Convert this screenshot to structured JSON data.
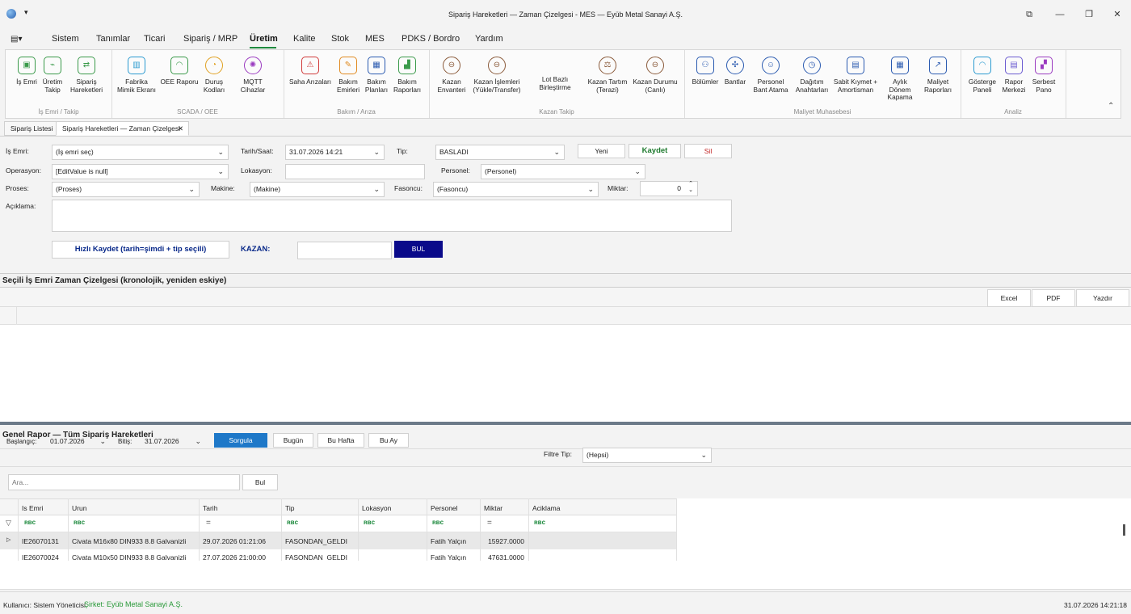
{
  "window": {
    "title": "Sipariş Hareketleri — Zaman Çizelgesi - MES — Eyüb Metal Sanayi A.Ş."
  },
  "menu": {
    "items": [
      "Sistem",
      "Tanımlar",
      "Ticari",
      "Sipariş / MRP",
      "Üretim",
      "Kalite",
      "Stok",
      "MES",
      "PDKS / Bordro",
      "Yardım"
    ],
    "active": "Üretim"
  },
  "ribbon": {
    "groups": {
      "is_emri": "İş Emri / Takip",
      "scada": "SCADA / OEE",
      "bakim": "Bakım / Arıza",
      "kazan": "Kazan Takip",
      "maliyet": "Maliyet Muhasebesi",
      "analiz": "Analiz"
    },
    "buttons": [
      {
        "label": "İş Emri",
        "icon": "work-order-icon",
        "color": "#3a9a4a"
      },
      {
        "label": "Üretim Takip",
        "icon": "production-track-icon",
        "color": "#3a9a4a"
      },
      {
        "label": "Sipariş Hareketleri",
        "icon": "order-movements-icon",
        "color": "#3a9a4a"
      },
      {
        "label": "Fabrika Mimik Ekranı",
        "icon": "factory-mimic-icon",
        "color": "#2a9ad0"
      },
      {
        "label": "OEE Raporu",
        "icon": "oee-report-icon",
        "color": "#3a9a4a"
      },
      {
        "label": "Duruş Kodları",
        "icon": "downtime-codes-icon",
        "color": "#e0a020"
      },
      {
        "label": "MQTT Cihazlar",
        "icon": "mqtt-devices-icon",
        "color": "#9a3ac0"
      },
      {
        "label": "Saha Arızaları",
        "icon": "field-faults-icon",
        "color": "#d03a3a"
      },
      {
        "label": "Bakım Emirleri",
        "icon": "maintenance-orders-icon",
        "color": "#e08a20"
      },
      {
        "label": "Bakım Planları",
        "icon": "maintenance-plans-icon",
        "color": "#2a5ab0"
      },
      {
        "label": "Bakım Raporları",
        "icon": "maintenance-reports-icon",
        "color": "#3a9a4a"
      },
      {
        "label": "Kazan Envanteri",
        "icon": "kettle-inventory-icon",
        "color": "#8a5a3a"
      },
      {
        "label": "Kazan İşlemleri (Yükle/Transfer)",
        "icon": "kettle-operations-icon",
        "color": "#8a5a3a"
      },
      {
        "label": "Lot Bazlı Birleştirme",
        "icon": "",
        "color": ""
      },
      {
        "label": "Kazan Tartım (Terazi)",
        "icon": "scale-icon",
        "color": "#8a5a3a"
      },
      {
        "label": "Kazan Durumu (Canlı)",
        "icon": "kettle-status-icon",
        "color": "#8a5a3a"
      },
      {
        "label": "Bölümler",
        "icon": "departments-icon",
        "color": "#2a5ab0"
      },
      {
        "label": "Bantlar",
        "icon": "lines-icon",
        "color": "#2a5ab0"
      },
      {
        "label": "Personel Bant Atama",
        "icon": "staff-assign-icon",
        "color": "#2a5ab0"
      },
      {
        "label": "Dağıtım Anahtarları",
        "icon": "distribution-keys-icon",
        "color": "#2a5ab0"
      },
      {
        "label": "Sabit Kıymet + Amortisman",
        "icon": "fixed-asset-icon",
        "color": "#2a5ab0"
      },
      {
        "label": "Aylık Dönem Kapama",
        "icon": "period-close-icon",
        "color": "#2a5ab0"
      },
      {
        "label": "Maliyet Raporları",
        "icon": "cost-reports-icon",
        "color": "#2a5ab0"
      },
      {
        "label": "Gösterge Paneli",
        "icon": "dashboard-icon",
        "color": "#2a9ad0"
      },
      {
        "label": "Rapor Merkezi",
        "icon": "report-center-icon",
        "color": "#6a5ad0"
      },
      {
        "label": "Serbest Pano",
        "icon": "free-board-icon",
        "color": "#9a3ac0"
      }
    ]
  },
  "doc_tabs": [
    {
      "label": "Sipariş Listesi"
    },
    {
      "label": "Sipariş Hareketleri — Zaman Çizelgesi"
    }
  ],
  "form": {
    "is_emri_label": "İş Emri:",
    "is_emri_value": "(İş emri seç)",
    "tarih_label": "Tarih/Saat:",
    "tarih_value": "31.07.2026 14:21",
    "tip_label": "Tip:",
    "tip_value": "BASLADI",
    "yeni": "Yeni",
    "kaydet": "Kaydet",
    "sil": "Sil",
    "operasyon_label": "Operasyon:",
    "operasyon_value": "[EditValue is null]",
    "lokasyon_label": "Lokasyon:",
    "lokasyon_value": "",
    "personel_label": "Personel:",
    "personel_value": "(Personel)",
    "proses_label": "Proses:",
    "proses_value": "(Proses)",
    "makine_label": "Makine:",
    "makine_value": "(Makine)",
    "fasoncu_label": "Fasoncu:",
    "fasoncu_value": "(Fasoncu)",
    "miktar_label": "Miktar:",
    "miktar_value": "0",
    "aciklama_label": "Açıklama:",
    "aciklama_value": "",
    "hizli_kaydet": "Hızlı Kaydet (tarih=şimdi + tip seçili)",
    "kazan_label": "KAZAN:",
    "kazan_value": "",
    "bul": "BUL"
  },
  "timeline": {
    "title": "Seçili İş Emri Zaman Çizelgesi (kronolojik, yeniden eskiye)",
    "excel": "Excel",
    "pdf": "PDF",
    "yazdir": "Yazdır"
  },
  "report": {
    "title": "Genel Rapor — Tüm Sipariş Hareketleri",
    "baslangic_label": "Başlangıç:",
    "baslangic_value": "01.07.2026",
    "bitis_label": "Bitiş:",
    "bitis_value": "31.07.2026",
    "sorgula": "Sorgula",
    "bugun": "Bugün",
    "bu_hafta": "Bu Hafta",
    "bu_ay": "Bu Ay",
    "filtre_tip_label": "Filtre Tip:",
    "filtre_tip_value": "(Hepsi)",
    "search_placeholder": "Ara...",
    "bul": "Bul",
    "columns": [
      "Is Emri",
      "Urun",
      "Tarih",
      "Tip",
      "Lokasyon",
      "Personel",
      "Miktar",
      "Aciklama"
    ],
    "filter_eq": "=",
    "rows": [
      {
        "is_emri": "IE26070131",
        "urun": "Civata M16x80 DIN933 8.8 Galvanizli",
        "tarih": "29.07.2026 01:21:06",
        "tip": "FASONDAN_GELDI",
        "lokasyon": "",
        "personel": "Fatih Yalçın",
        "miktar": "15927.0000",
        "aciklama": ""
      },
      {
        "is_emri": "IE26070024",
        "urun": "Civata M10x50 DIN933 8.8 Galvanizli",
        "tarih": "27.07.2026 21:00:00",
        "tip": "FASONDAN_GELDI",
        "lokasyon": "",
        "personel": "Fatih Yalçın",
        "miktar": "47631.0000",
        "aciklama": ""
      }
    ]
  },
  "status": {
    "kullanici": "Kullanıcı: Sistem Yöneticisi",
    "sirket": "Şirket: Eyüb Metal Sanayi A.Ş.",
    "datetime": "31.07.2026 14:21:18"
  },
  "colors": {
    "accent": "#1e8a3e",
    "primary_button": "#1e78c8",
    "bul_button": "#0a0a8a",
    "kaydet_text": "#1e7a2e",
    "sil_text": "#c02020",
    "company_text": "#2a9a3a"
  }
}
